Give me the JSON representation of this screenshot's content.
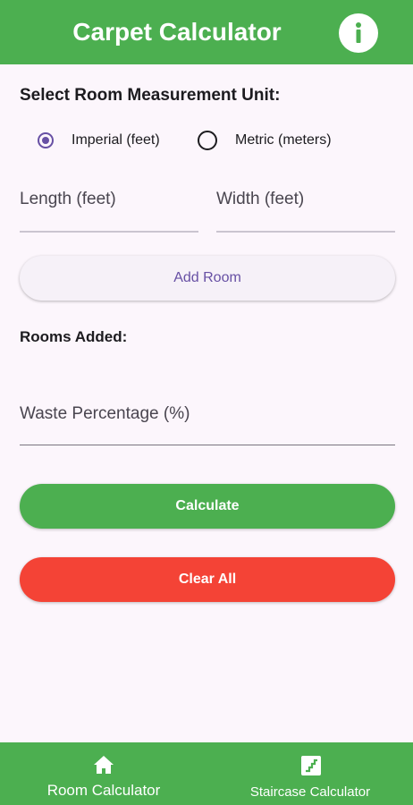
{
  "app_bar": {
    "title": "Carpet Calculator",
    "info_icon": "info-icon",
    "background": "#4caf50"
  },
  "unit_selection": {
    "title": "Select Room Measurement Unit:",
    "options": [
      {
        "label": "Imperial (feet)",
        "selected": true
      },
      {
        "label": "Metric (meters)",
        "selected": false
      }
    ]
  },
  "room_inputs": {
    "length_label": "Length (feet)",
    "width_label": "Width (feet)",
    "add_room_label": "Add Room"
  },
  "rooms": {
    "title": "Rooms Added:"
  },
  "waste": {
    "label": "Waste Percentage (%)"
  },
  "actions": {
    "calculate_label": "Calculate",
    "clear_label": "Clear All",
    "calculate_color": "#4caf50",
    "clear_color": "#f44336"
  },
  "bottom_nav": {
    "items": [
      {
        "label": "Room Calculator",
        "icon": "home-icon"
      },
      {
        "label": "Staircase Calculator",
        "icon": "stairs-icon"
      }
    ]
  }
}
